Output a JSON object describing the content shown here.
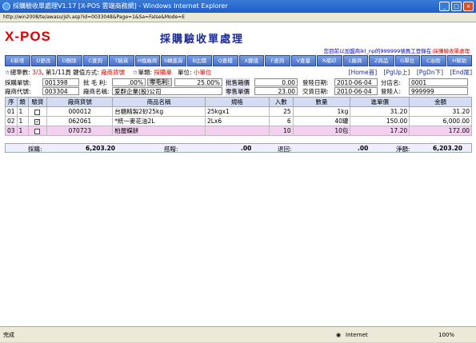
{
  "window": {
    "title": "採購驗收單處理V1.17 [X-POS 雲端商務網] - Windows Internet Explorer",
    "address": "http://win2008/te/awasu/jsh.asp?id=0033048&Page=1&Sa=False&Mode=E"
  },
  "header": {
    "logo": "X-POS",
    "page_title": "採購驗收單處理",
    "notice_prefix": "您目前以加盟商ikl_np的999999號員工登錄在:",
    "notice_location": "採購驗收單處理"
  },
  "toolbar": {
    "buttons": [
      "E新增",
      "D更改",
      "D刪除",
      "C查詢",
      "T驗貨",
      "H換廠商",
      "S轉進貨",
      "B比價",
      "Q查檔",
      "X鍵值",
      "F查詢",
      "V查量",
      "R補印",
      "L廠商",
      "Z商品",
      "G單位",
      "C治政",
      "H幫助"
    ]
  },
  "status": {
    "total_label": "☆總筆數:",
    "total_value": "3/3",
    "page_text": "第1/11頁",
    "key_label": "鍵值方式:",
    "key_value": "廠商貨號",
    "doc_label": "☆單類:",
    "doc_value": "採購單",
    "unit_label": "單位:",
    "unit_value": "小單位",
    "nav": [
      "[Home首]",
      "[PgUp上]",
      "[PgDn下]",
      "[End尾]"
    ]
  },
  "form": {
    "po_no_label": "採購單號:",
    "po_no": "001398",
    "margin_label": "批 毛 利:",
    "margin_value": ".00%",
    "zero_margin_button": "零毛利:",
    "zero_margin_value": "25.00%",
    "wholesale_label": "批售箱價",
    "wholesale_value": "0.00",
    "login_date_label": "登陸日期:",
    "login_date": "2010-06-04",
    "branch_label": "分店名:",
    "branch_value": "0001",
    "vendor_code_label": "廠商代號:",
    "vendor_code": "003304",
    "vendor_name_label": "廠商名稱:",
    "vendor_name": "爱群企業(股)公司",
    "retail_label": "零售單價",
    "retail_value": "23.00",
    "delivery_date_label": "交貨日期:",
    "delivery_date": "2010-06-04",
    "login_user_label": "登陸人:",
    "login_user": "999999"
  },
  "table": {
    "headers": [
      "序",
      "類",
      "驗貨",
      "廠商貨號",
      "商品名稱",
      "規格",
      "入數",
      "數量",
      "進單價",
      "金額"
    ],
    "rows": [
      {
        "seq": "01",
        "type": "1",
        "checked": false,
        "code": "000012",
        "name": "台糖精製2砂25kg",
        "spec": "25kgx1",
        "pack": "25",
        "qty": "1kg",
        "price": "31.20",
        "amount": "31.20"
      },
      {
        "seq": "02",
        "type": "1",
        "checked": true,
        "code": "062061",
        "name": "*統一麥花油2L",
        "spec": "2Lx6",
        "pack": "6",
        "qty": "40罐",
        "price": "150.00",
        "amount": "6,000.00"
      },
      {
        "seq": "03",
        "type": "1",
        "checked": false,
        "code": "070723",
        "name": "柏屋蝶餅",
        "spec": "",
        "pack": "10",
        "qty": "10包",
        "price": "17.20",
        "amount": "172.00"
      }
    ]
  },
  "totals": {
    "purchase_label": "採購:",
    "purchase_value": "6,203.20",
    "discount_label": "搭贈:",
    "discount_value": ".00",
    "return_label": "退回:",
    "return_value": ".00",
    "net_label": "淨額:",
    "net_value": "6,203.20"
  },
  "statusbar": {
    "left": "完成",
    "zone": "Internet",
    "zoom": "100%"
  }
}
